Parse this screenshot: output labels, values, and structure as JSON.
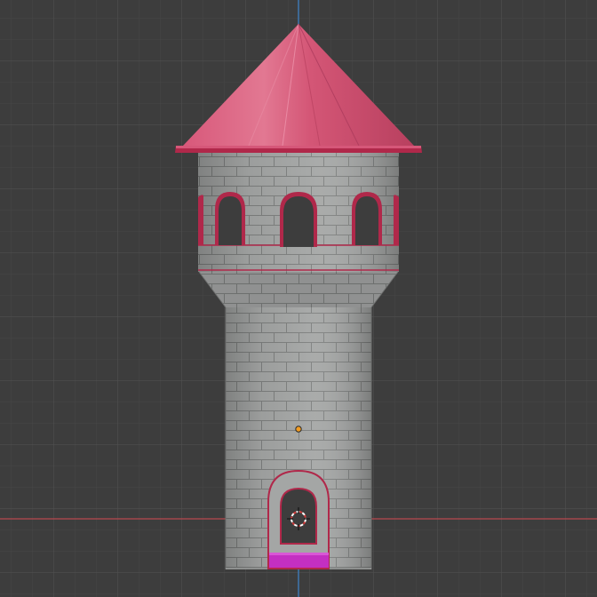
{
  "viewport": {
    "view": "front-orthographic",
    "background_color": "#3d3d3d",
    "grid_minor_color": "#474747",
    "grid_major_color": "#515151",
    "x_axis_color": "#b84a4f",
    "z_axis_color": "#3f77b2"
  },
  "model": {
    "name_icon": "castle-tower",
    "wall_color": "#a4a6a5",
    "mortar_color": "#7f8180",
    "roof_color": "#c94a6c",
    "roof_highlight": "#e27892",
    "trim_color": "#b0284a",
    "window_count_visible": 3,
    "door_floor_color": "#c42fc2"
  },
  "gizmos": {
    "origin_icon": "object-origin-icon",
    "cursor_icon": "3d-cursor-icon"
  }
}
